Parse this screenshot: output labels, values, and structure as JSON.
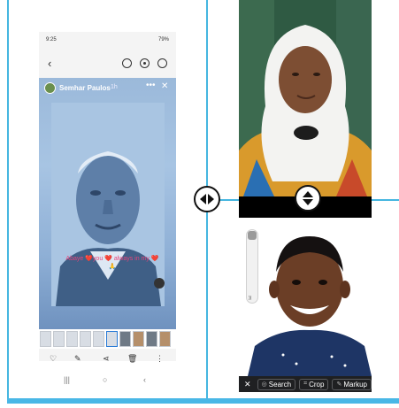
{
  "phone": {
    "status": {
      "time": "9:25",
      "battery": "79%"
    },
    "story": {
      "user_name": "Semhar Paulos",
      "time_ago": "1h",
      "overlay_text": "Abaye ❤️you ❤️ always in my ❤️🙏"
    },
    "icons": {
      "back": "back-arrow-icon",
      "toolbar": [
        "rotate-icon",
        "eye-icon",
        "remix-icon"
      ],
      "actions": [
        "heart-icon",
        "edit-icon",
        "share-icon",
        "delete-icon",
        "more-icon"
      ],
      "nav": [
        "recents-icon",
        "home-icon",
        "back-nav-icon"
      ]
    },
    "glyphs": {
      "back": "‹",
      "more": "•••",
      "close": "✕",
      "heart": "♡",
      "edit": "✎",
      "share": "⋖",
      "delete": "🗑",
      "more_vert": "⋮",
      "recents": "|||",
      "home": "○",
      "nav_back": "‹"
    }
  },
  "right_panel": {
    "side_tool_label": "))",
    "toolbar": {
      "close_label": "✕",
      "search_label": "Search",
      "crop_label": "Crop",
      "markup_label": "Markup"
    }
  },
  "colors": {
    "frame": "#45b6e0",
    "story_tint": "#9bb9da",
    "toolbar_bg": "#1f2022"
  }
}
